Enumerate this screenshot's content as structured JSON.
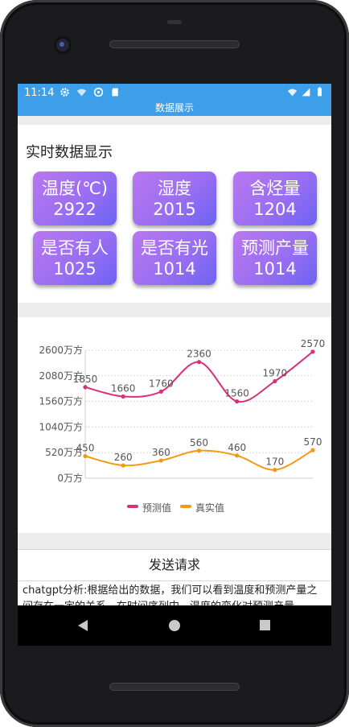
{
  "status_bar": {
    "time": "11:14"
  },
  "app_bar": {
    "title": "数据展示"
  },
  "realtime": {
    "title": "实时数据显示",
    "tiles": [
      {
        "label": "温度(℃)",
        "value": "2922"
      },
      {
        "label": "湿度",
        "value": "2015"
      },
      {
        "label": "含烃量",
        "value": "1204"
      },
      {
        "label": "是否有人",
        "value": "1025"
      },
      {
        "label": "是否有光",
        "value": "1014"
      },
      {
        "label": "预测产量",
        "value": "1014"
      }
    ]
  },
  "chart_data": {
    "type": "line",
    "x": [
      1,
      2,
      3,
      4,
      5,
      6,
      7
    ],
    "ylim": [
      0,
      2600
    ],
    "yticks": [
      "0万方",
      "520万方",
      "1040万方",
      "1560万方",
      "2080万方",
      "2600万方"
    ],
    "grid": true,
    "legend_position": "bottom",
    "series": [
      {
        "name": "预测值",
        "color": "#d6317a",
        "values": [
          1850,
          1660,
          1760,
          2360,
          1560,
          1970,
          2570
        ]
      },
      {
        "name": "真实值",
        "color": "#f39a13",
        "values": [
          450,
          260,
          360,
          560,
          460,
          170,
          570
        ]
      }
    ]
  },
  "request": {
    "send_label": "发送请求",
    "analysis_text": "chatgpt分析:根据给出的数据，我们可以看到温度和预测产量之间存在一定的关系。在时间序列中，温度的变化对预测产量"
  },
  "colors": {
    "accent": "#3d9fea",
    "tile_start": "#b977f0",
    "tile_end": "#6c63f2"
  }
}
